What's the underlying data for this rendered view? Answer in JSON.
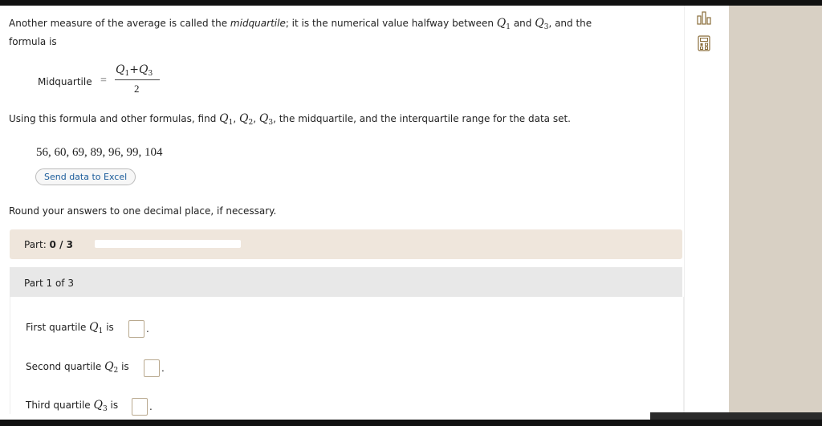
{
  "intro": {
    "line1_a": "Another measure of the average is called the ",
    "line1_term": "midquartile",
    "line1_b": "; it is the numerical value halfway between ",
    "q1": "Q",
    "q1_sub": "1",
    "and": " and ",
    "q3": "Q",
    "q3_sub": "3",
    "line1_c": ", and the",
    "line2": "formula is"
  },
  "formula": {
    "label": "Midquartile",
    "equals": "=",
    "numerator_q1": "Q",
    "numerator_q1_sub": "1",
    "plus": "+",
    "numerator_q3": "Q",
    "numerator_q3_sub": "3",
    "denominator": "2"
  },
  "instruction": {
    "text_a": "Using this formula and other formulas, find ",
    "q1": "Q",
    "q1_sub": "1",
    "q2": "Q",
    "q2_sub": "2",
    "q3": "Q",
    "q3_sub": "3",
    "text_b": ", the midquartile, and the interquartile range for the data set."
  },
  "data_set": "56, 60, 69, 89, 96, 99, 104",
  "excel_button": "Send data to Excel",
  "round_note": "Round your answers to one decimal place, if necessary.",
  "part_progress": {
    "label": "Part: ",
    "value": "0 / 3",
    "fraction_complete": 0
  },
  "part_header": "Part 1 of 3",
  "questions": [
    {
      "prefix": "First quartile ",
      "var": "Q",
      "sub": "1",
      "suffix": " is"
    },
    {
      "prefix": "Second quartile ",
      "var": "Q",
      "sub": "2",
      "suffix": " is"
    },
    {
      "prefix": "Third quartile ",
      "var": "Q",
      "sub": "3",
      "suffix": " is"
    }
  ],
  "period": ".",
  "tools": [
    "bar-chart-icon",
    "calculator-icon"
  ]
}
